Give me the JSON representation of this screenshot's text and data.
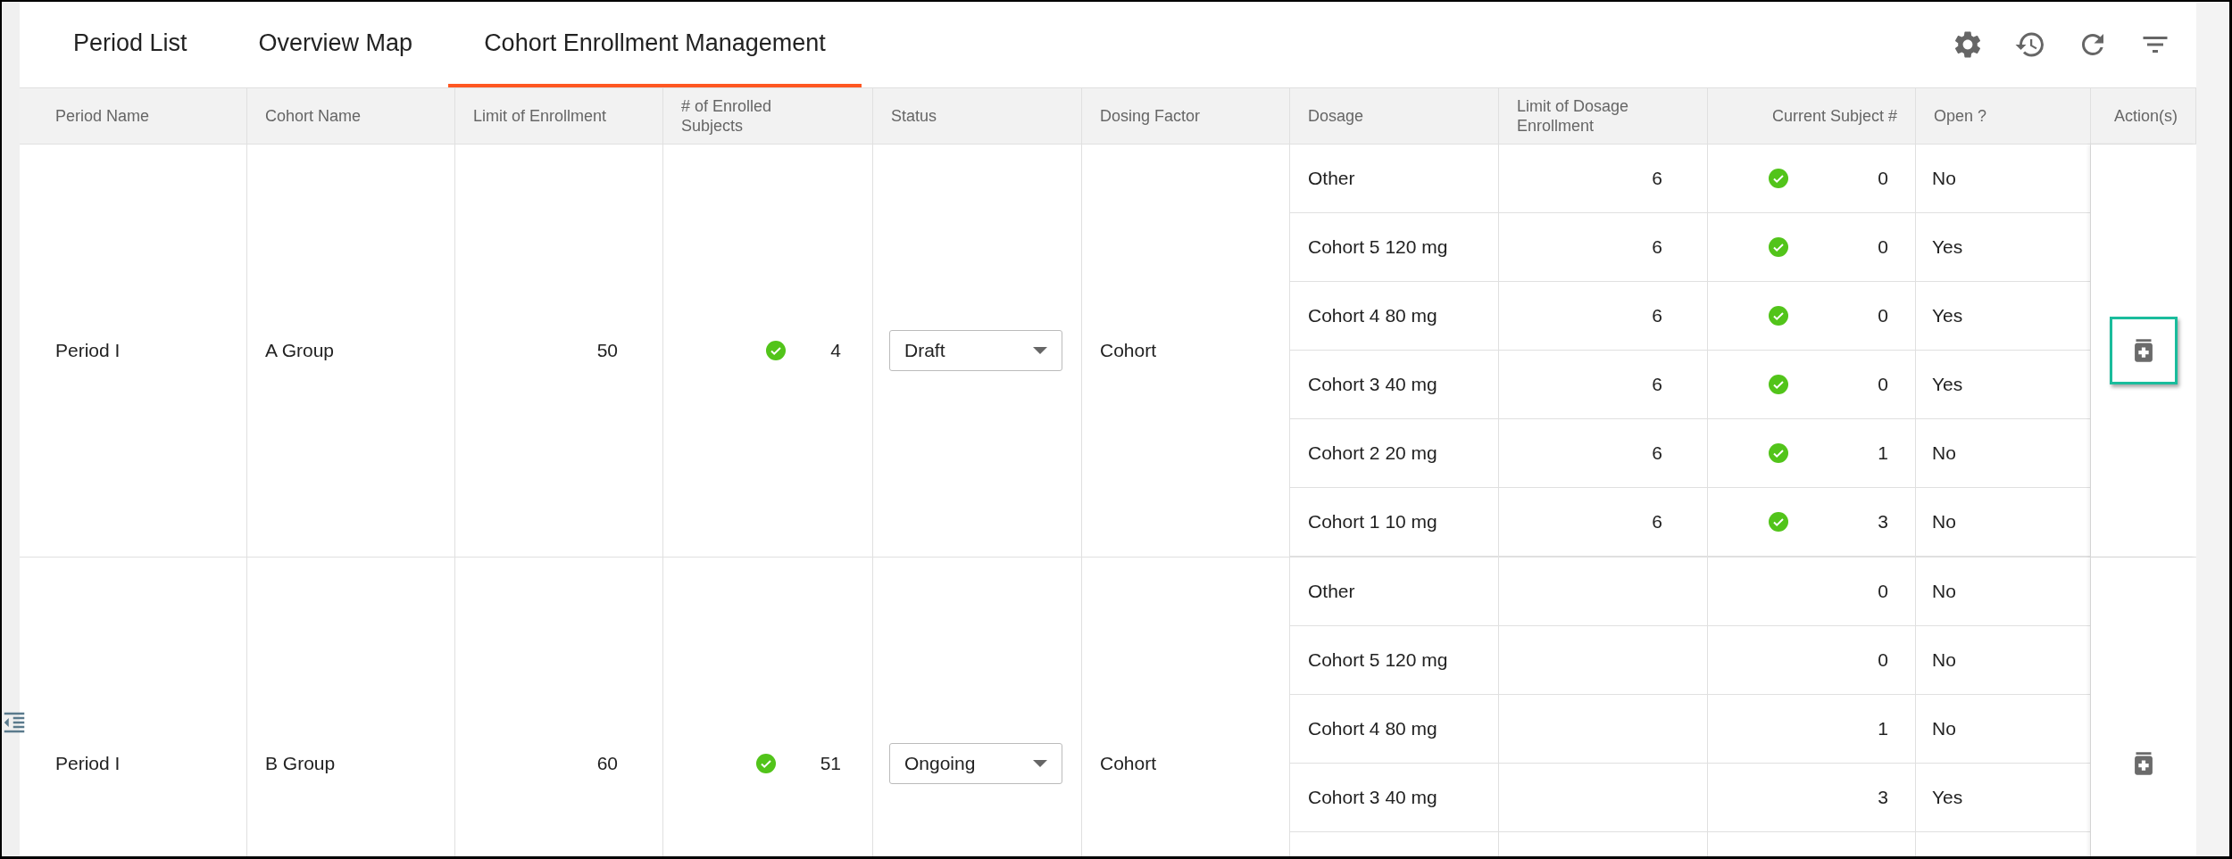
{
  "tabs": [
    {
      "label": "Period List",
      "selected": false
    },
    {
      "label": "Overview Map",
      "selected": false
    },
    {
      "label": "Cohort Enrollment Management",
      "selected": true
    }
  ],
  "table": {
    "columns": [
      "Period Name",
      "Cohort Name",
      "Limit of Enrollment",
      "# of Enrolled Subjects",
      "Status",
      "Dosing Factor",
      "Dosage",
      "Limit of Dosage Enrollment",
      "Current Subject #",
      "Open ?",
      "Action(s)"
    ],
    "groups": [
      {
        "period": "Period I",
        "cohort": "A Group",
        "limit": "50",
        "enrolled_ok": true,
        "enrolled": "4",
        "status": "Draft",
        "dosing_factor": "Cohort",
        "action_focused": true,
        "dosages": [
          {
            "dosage": "Other",
            "limit": "6",
            "ok": true,
            "current": "0",
            "open": "No"
          },
          {
            "dosage": "Cohort 5 120 mg",
            "limit": "6",
            "ok": true,
            "current": "0",
            "open": "Yes"
          },
          {
            "dosage": "Cohort 4 80 mg",
            "limit": "6",
            "ok": true,
            "current": "0",
            "open": "Yes"
          },
          {
            "dosage": "Cohort 3 40 mg",
            "limit": "6",
            "ok": true,
            "current": "0",
            "open": "Yes"
          },
          {
            "dosage": "Cohort 2 20 mg",
            "limit": "6",
            "ok": true,
            "current": "1",
            "open": "No"
          },
          {
            "dosage": "Cohort 1 10 mg",
            "limit": "6",
            "ok": true,
            "current": "3",
            "open": "No"
          }
        ]
      },
      {
        "period": "Period I",
        "cohort": "B Group",
        "limit": "60",
        "enrolled_ok": true,
        "enrolled": "51",
        "status": "Ongoing",
        "dosing_factor": "Cohort",
        "action_focused": false,
        "dosages": [
          {
            "dosage": "Other",
            "ok": false,
            "current": "0",
            "open": "No"
          },
          {
            "dosage": "Cohort 5 120 mg",
            "ok": false,
            "current": "0",
            "open": "No"
          },
          {
            "dosage": "Cohort 4 80 mg",
            "ok": false,
            "current": "1",
            "open": "No"
          },
          {
            "dosage": "Cohort 3 40 mg",
            "ok": false,
            "current": "3",
            "open": "Yes"
          }
        ]
      }
    ]
  }
}
